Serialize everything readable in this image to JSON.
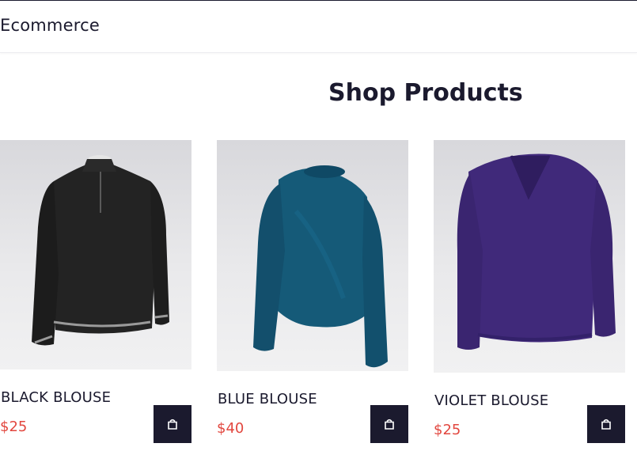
{
  "header": {
    "brand": "Ecommerce"
  },
  "main": {
    "title": "Shop Products"
  },
  "products": [
    {
      "name": "BLACK BLOUSE",
      "price": "$25",
      "image": "black-blouse-image",
      "color": "#222222"
    },
    {
      "name": "BLUE BLOUSE",
      "price": "$40",
      "image": "blue-blouse-image",
      "color": "#145a7a"
    },
    {
      "name": "VIOLET BLOUSE",
      "price": "$25",
      "image": "violet-blouse-image",
      "color": "#3f2a77"
    }
  ],
  "icons": {
    "cart": "shopping-bag-icon"
  },
  "colors": {
    "text": "#1b1a2e",
    "price": "#e2473f",
    "button": "#1b1a2e"
  }
}
